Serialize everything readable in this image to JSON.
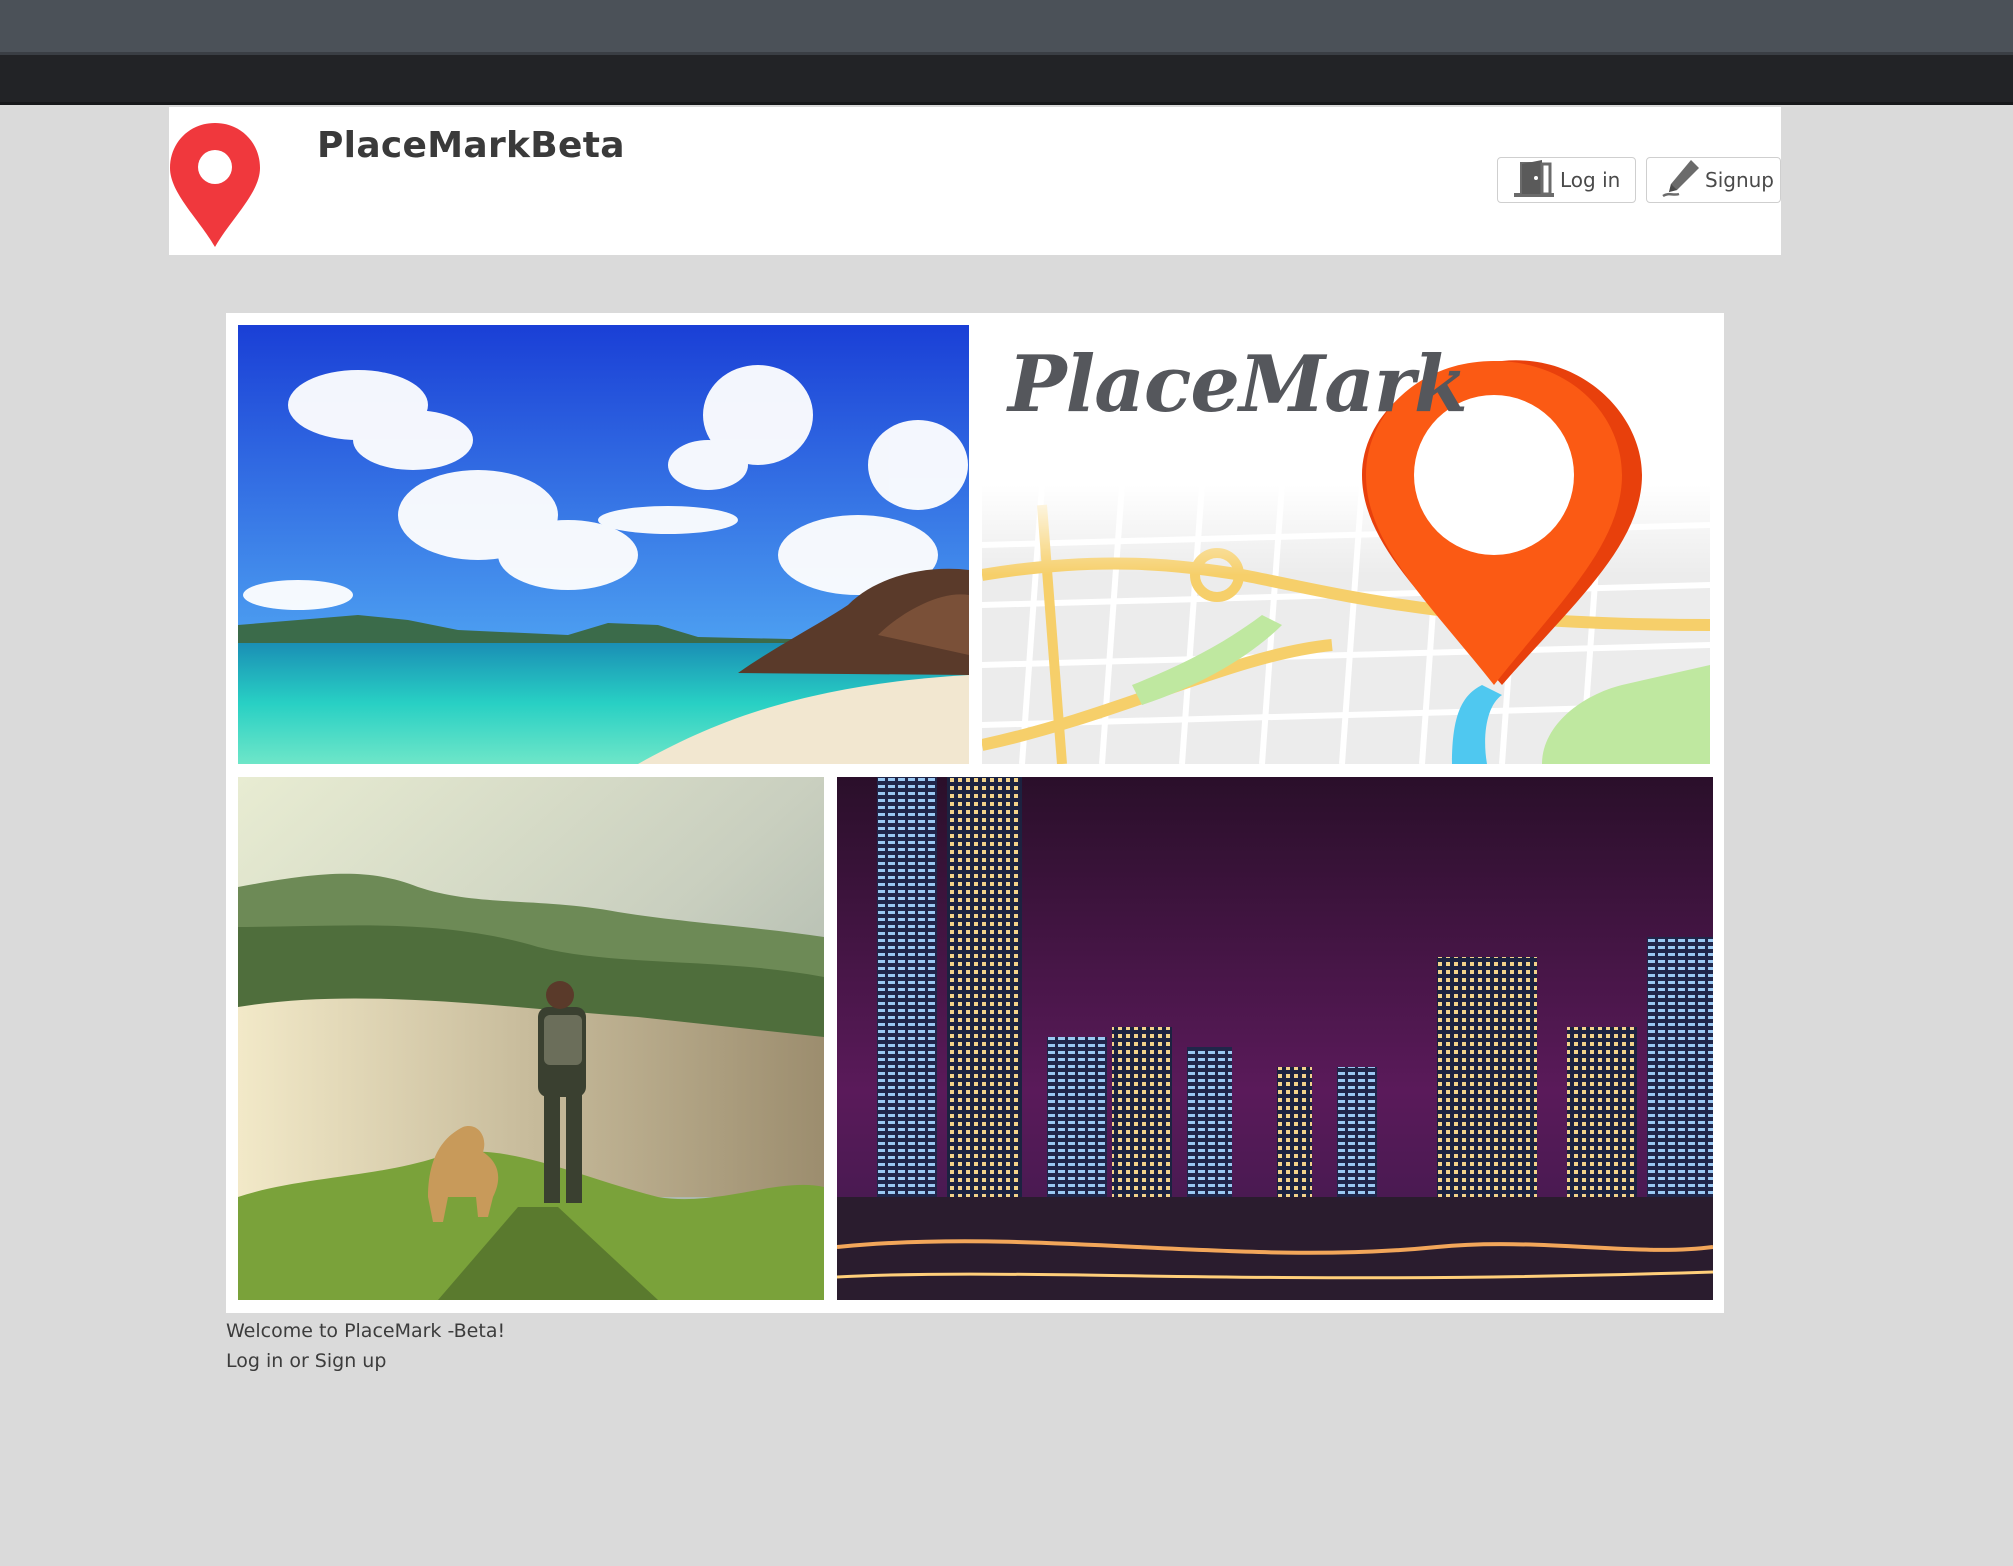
{
  "header": {
    "brand": "PlaceMarkBeta",
    "login_label": "Log in",
    "signup_label": "Signup"
  },
  "hero": {
    "logo_title": "PlaceMark"
  },
  "welcome": {
    "line1": "Welcome to PlaceMark -Beta!",
    "line2": "Log in or Sign up"
  },
  "icons": {
    "brand_logo": "map-pin-icon",
    "login": "door-icon",
    "signup": "pen-icon"
  },
  "colors": {
    "pin_red": "#f0383d",
    "pin_orange": "#f05a1a",
    "page_background": "#dadada",
    "navbar_background": "#ffffff"
  }
}
